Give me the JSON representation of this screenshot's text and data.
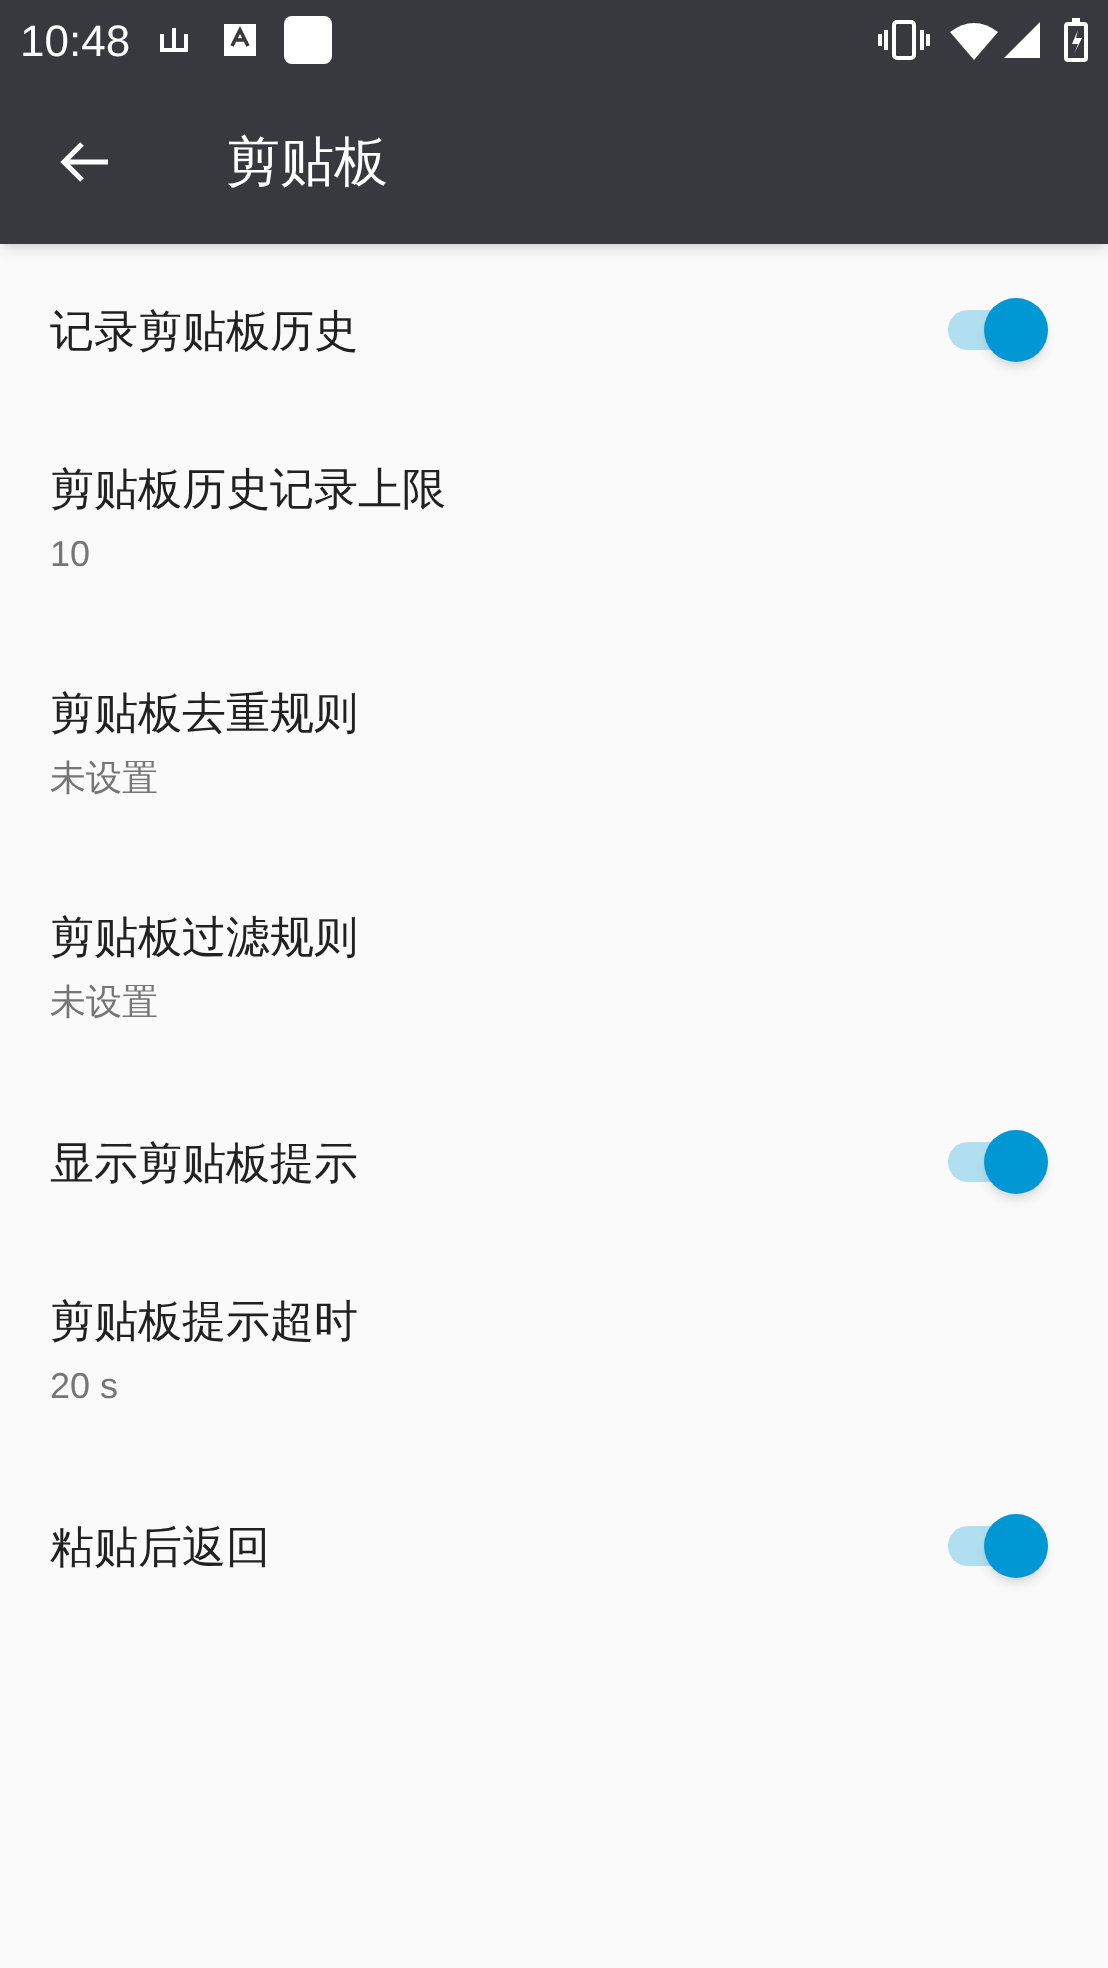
{
  "status_bar": {
    "time": "10:48"
  },
  "app_bar": {
    "title": "剪贴板"
  },
  "settings": [
    {
      "kind": "switch",
      "title": "记录剪贴板历史",
      "on": true
    },
    {
      "kind": "text",
      "title": "剪贴板历史记录上限",
      "summary": "10"
    },
    {
      "kind": "text",
      "title": "剪贴板去重规则",
      "summary": "未设置"
    },
    {
      "kind": "text",
      "title": "剪贴板过滤规则",
      "summary": "未设置"
    },
    {
      "kind": "switch",
      "title": "显示剪贴板提示",
      "on": true
    },
    {
      "kind": "text",
      "title": "剪贴板提示超时",
      "summary": "20 s"
    },
    {
      "kind": "switch",
      "title": "粘贴后返回",
      "on": true
    }
  ]
}
